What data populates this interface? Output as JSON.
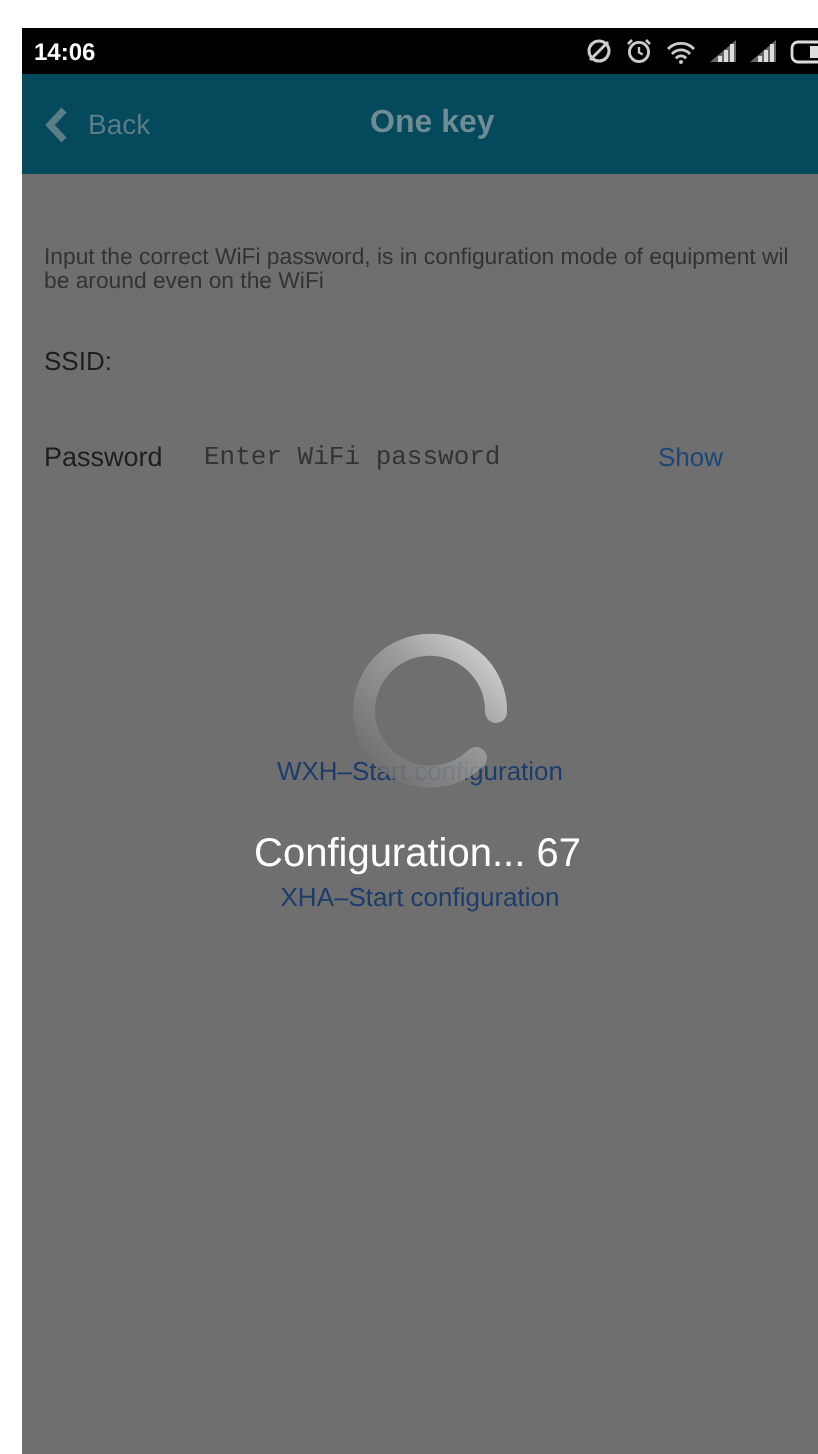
{
  "status_bar": {
    "time": "14:06"
  },
  "header": {
    "back_label": "Back",
    "title": "One key"
  },
  "hint_lines": [
    "Input the correct WiFi password, is in configuration mode of equipment wil",
    "be around even on the WiFi"
  ],
  "ssid": {
    "label": "SSID:"
  },
  "password": {
    "label": "Password",
    "placeholder": "Enter WiFi password",
    "show_label": "Show"
  },
  "buttons": [
    {
      "label": "WXH–Start configuration"
    },
    {
      "label": "XHA–Start configuration"
    }
  ],
  "progress": {
    "text": "Configuration... 67"
  }
}
